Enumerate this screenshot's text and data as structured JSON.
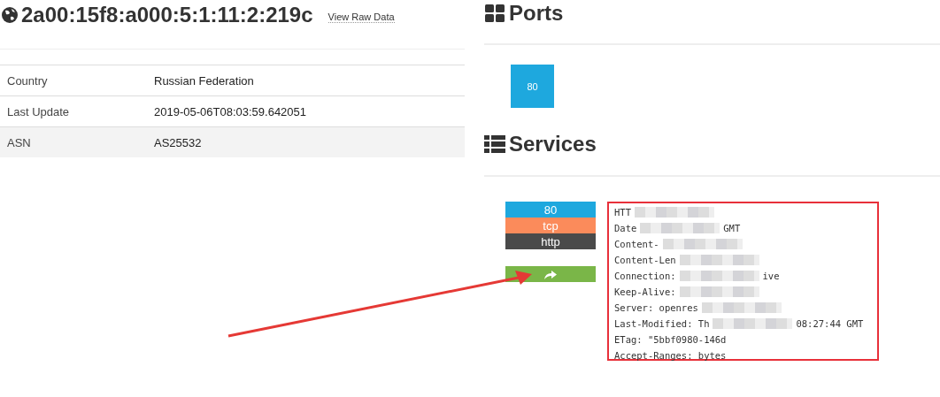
{
  "host": {
    "title": "2a00:15f8:a000:5:1:11:2:219c",
    "raw_link": "View Raw Data"
  },
  "details": [
    {
      "label": "Country",
      "value": "Russian Federation"
    },
    {
      "label": "Last Update",
      "value": "2019-05-06T08:03:59.642051"
    },
    {
      "label": "ASN",
      "value": "AS25532"
    }
  ],
  "ports": {
    "title": "Ports",
    "items": [
      "80"
    ]
  },
  "services": {
    "title": "Services",
    "port": "80",
    "transport": "tcp",
    "module": "http",
    "banner": [
      {
        "before": "HTT",
        "redacted": true
      },
      {
        "before": "Date",
        "redacted": true,
        "after": "GMT"
      },
      {
        "before": "Content-",
        "redacted": true
      },
      {
        "before": "Content-Len",
        "redacted": true
      },
      {
        "before": "Connection:",
        "redacted": true,
        "after": "ive"
      },
      {
        "before": "Keep-Alive:",
        "redacted": true
      },
      {
        "before": "Server: openres",
        "redacted": true
      },
      {
        "before": "Last-Modified: Th",
        "redacted": true,
        "after": "08:27:44 GMT"
      },
      {
        "before": "ETag: \"5bbf0980-146d",
        "redacted": false
      },
      {
        "before": "Accept-Ranges: bytes",
        "redacted": false
      }
    ]
  }
}
